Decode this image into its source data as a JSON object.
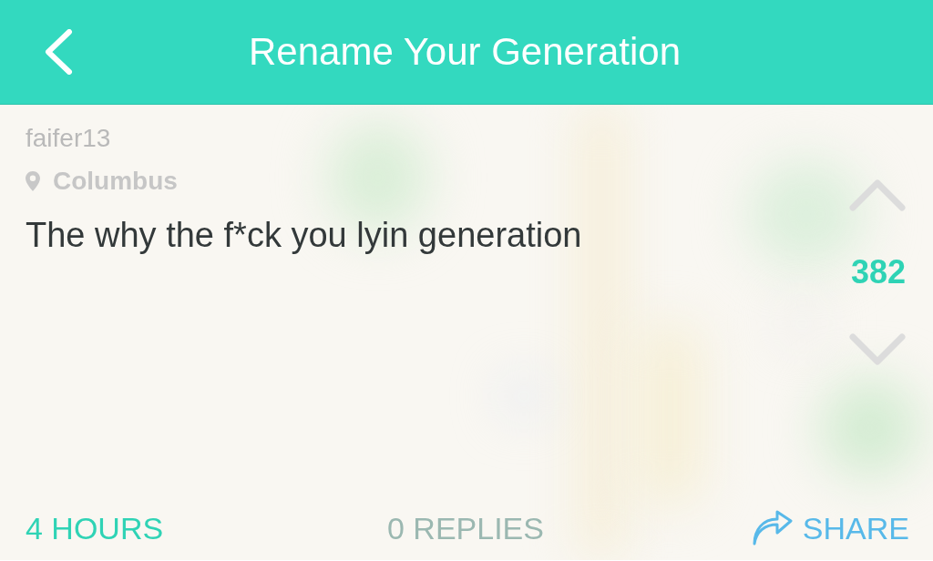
{
  "header": {
    "title": "Rename Your Generation"
  },
  "post": {
    "username": "faifer13",
    "location": "Columbus",
    "message": "The why the f*ck you lyin generation",
    "score": "382"
  },
  "footer": {
    "time": "4 HOURS",
    "replies": "0 REPLIES",
    "share": "SHARE"
  }
}
